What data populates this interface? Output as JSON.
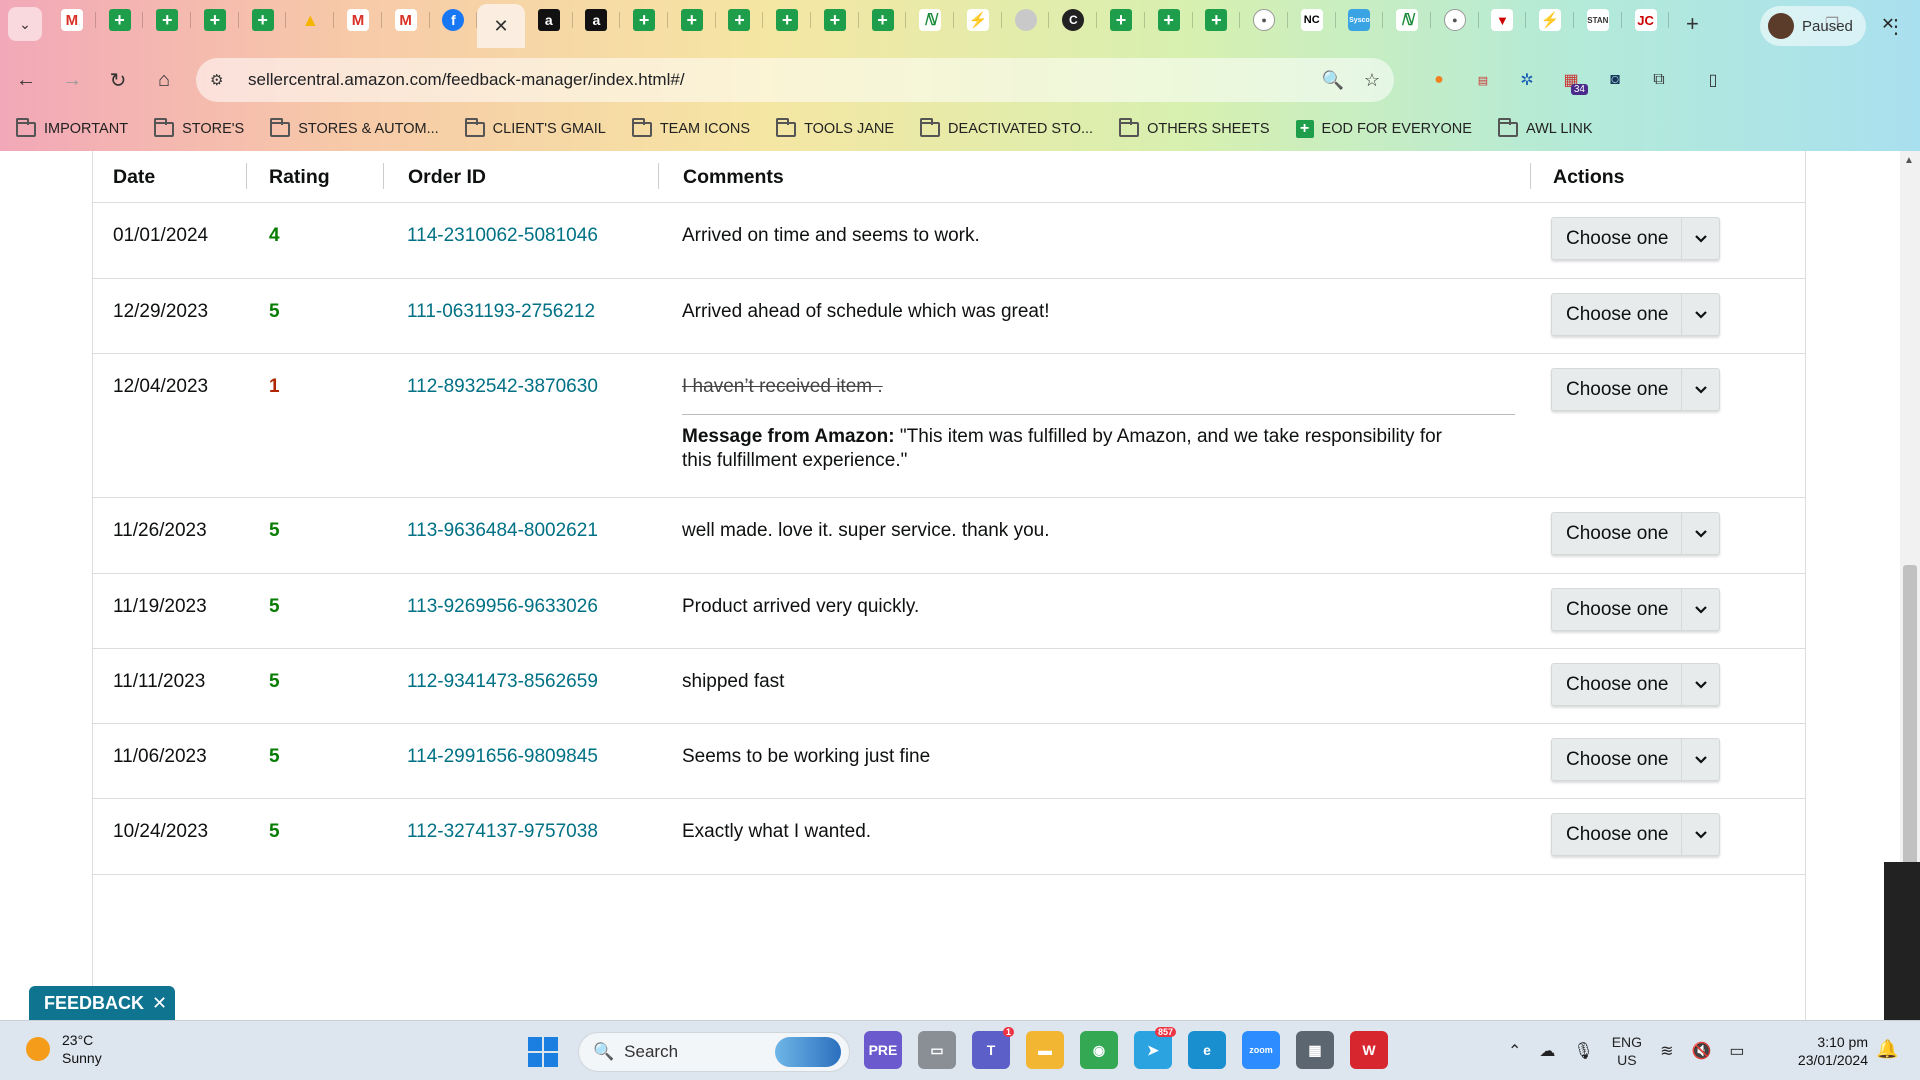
{
  "browser": {
    "tabs": [
      {
        "icon": "gmail-icon",
        "glyph": "M",
        "cls": "ic-gmail"
      },
      {
        "icon": "sheets-icon",
        "glyph": "+",
        "cls": "ic-sheet"
      },
      {
        "icon": "sheets-icon",
        "glyph": "+",
        "cls": "ic-sheet"
      },
      {
        "icon": "sheets-icon",
        "glyph": "+",
        "cls": "ic-sheet"
      },
      {
        "icon": "sheets-icon",
        "glyph": "+",
        "cls": "ic-sheet"
      },
      {
        "icon": "google-drive-icon",
        "glyph": "▲",
        "cls": "ic-drive"
      },
      {
        "icon": "gmail-icon",
        "glyph": "M",
        "cls": "ic-gmail"
      },
      {
        "icon": "gmail-icon",
        "glyph": "M",
        "cls": "ic-gmail"
      },
      {
        "icon": "facebook-icon",
        "glyph": "f",
        "cls": "ic-fb"
      },
      {
        "icon": "close-icon",
        "glyph": "✕",
        "cls": "ic-close",
        "active": true
      },
      {
        "icon": "amazon-icon",
        "glyph": "a",
        "cls": "ic-amazon"
      },
      {
        "icon": "amazon-icon",
        "glyph": "a",
        "cls": "ic-amazon"
      },
      {
        "icon": "sheets-icon",
        "glyph": "+",
        "cls": "ic-sheet"
      },
      {
        "icon": "sheets-icon",
        "glyph": "+",
        "cls": "ic-sheet"
      },
      {
        "icon": "sheets-icon",
        "glyph": "+",
        "cls": "ic-sheet"
      },
      {
        "icon": "sheets-icon",
        "glyph": "+",
        "cls": "ic-sheet"
      },
      {
        "icon": "sheets-icon",
        "glyph": "+",
        "cls": "ic-sheet"
      },
      {
        "icon": "sheets-icon",
        "glyph": "+",
        "cls": "ic-sheet"
      },
      {
        "icon": "n-logo-icon",
        "glyph": "ℕ",
        "cls": "ic-n"
      },
      {
        "icon": "zapier-icon",
        "glyph": "⚡",
        "cls": "ic-zap"
      },
      {
        "icon": "loading-icon",
        "glyph": "",
        "cls": "ic-grey"
      },
      {
        "icon": "c-logo-icon",
        "glyph": "C",
        "cls": "ic-c"
      },
      {
        "icon": "sheets-icon",
        "glyph": "+",
        "cls": "ic-sheet"
      },
      {
        "icon": "sheets-icon",
        "glyph": "+",
        "cls": "ic-sheet"
      },
      {
        "icon": "sheets-icon",
        "glyph": "+",
        "cls": "ic-sheet"
      },
      {
        "icon": "round-logo-icon",
        "glyph": "●",
        "cls": "ic-round"
      },
      {
        "icon": "nc-logo-icon",
        "glyph": "NC",
        "cls": "ic-nc"
      },
      {
        "icon": "sysco-logo-icon",
        "glyph": "Sysco",
        "cls": "ic-sysco"
      },
      {
        "icon": "n-logo-icon",
        "glyph": "ℕ",
        "cls": "ic-n"
      },
      {
        "icon": "round-logo-icon",
        "glyph": "●",
        "cls": "ic-round"
      },
      {
        "icon": "red-logo-icon",
        "glyph": "▼",
        "cls": "ic-red"
      },
      {
        "icon": "zapier-icon",
        "glyph": "⚡",
        "cls": "ic-zap"
      },
      {
        "icon": "stan-logo-icon",
        "glyph": "STAN",
        "cls": "ic-txt"
      },
      {
        "icon": "jc-logo-icon",
        "glyph": "JC",
        "cls": "ic-red"
      }
    ],
    "url": "sellercentral.amazon.com/feedback-manager/index.html#/",
    "profile_label": "Paused",
    "extension_badge": "34",
    "bookmarks": [
      {
        "label": "IMPORTANT",
        "type": "folder"
      },
      {
        "label": "STORE'S",
        "type": "folder"
      },
      {
        "label": "STORES & AUTOM...",
        "type": "folder"
      },
      {
        "label": "CLIENT'S GMAIL",
        "type": "folder"
      },
      {
        "label": "TEAM ICONS",
        "type": "folder"
      },
      {
        "label": "TOOLS JANE",
        "type": "folder"
      },
      {
        "label": "DEACTIVATED STO...",
        "type": "folder"
      },
      {
        "label": "OTHERS SHEETS",
        "type": "folder"
      },
      {
        "label": "EOD FOR EVERYONE",
        "type": "sheet"
      },
      {
        "label": "AWL LINK",
        "type": "folder"
      }
    ]
  },
  "table": {
    "headers": {
      "date": "Date",
      "rating": "Rating",
      "order_id": "Order ID",
      "comments": "Comments",
      "actions": "Actions"
    },
    "rows": [
      {
        "date": "01/01/2024",
        "rating": "4",
        "order_id": "114-2310062-5081046",
        "comment": "Arrived on time and seems to work.",
        "action": "Choose one"
      },
      {
        "date": "12/29/2023",
        "rating": "5",
        "order_id": "111-0631193-2756212",
        "comment": "Arrived ahead of schedule which was great!",
        "action": "Choose one"
      },
      {
        "date": "12/04/2023",
        "rating": "1",
        "order_id": "112-8932542-3870630",
        "comment": "I haven’t received item .",
        "struck": true,
        "amazon_label": "Message from Amazon:",
        "amazon_message": "\"This item was fulfilled by Amazon, and we take responsibility for this fulfillment experience.\"",
        "action": "Choose one"
      },
      {
        "date": "11/26/2023",
        "rating": "5",
        "order_id": "113-9636484-8002621",
        "comment": "well made. love it. super service. thank you.",
        "action": "Choose one"
      },
      {
        "date": "11/19/2023",
        "rating": "5",
        "order_id": "113-9269956-9633026",
        "comment": "Product arrived very quickly.",
        "action": "Choose one"
      },
      {
        "date": "11/11/2023",
        "rating": "5",
        "order_id": "112-9341473-8562659",
        "comment": "shipped fast",
        "action": "Choose one"
      },
      {
        "date": "11/06/2023",
        "rating": "5",
        "order_id": "114-2991656-9809845",
        "comment": "Seems to be working just fine",
        "action": "Choose one"
      },
      {
        "date": "10/24/2023",
        "rating": "5",
        "order_id": "112-3274137-9757038",
        "comment": "Exactly what I wanted.",
        "action": "Choose one"
      }
    ]
  },
  "feedback_tab": {
    "label": "FEEDBACK"
  },
  "taskbar": {
    "weather_temp": "23°C",
    "weather_desc": "Sunny",
    "search_label": "Search",
    "apps": [
      {
        "icon": "copilot-icon",
        "glyph": "PRE",
        "color": "#6a5acd"
      },
      {
        "icon": "file-manager-icon",
        "glyph": "▭",
        "color": "#8a8f96"
      },
      {
        "icon": "teams-icon",
        "glyph": "T",
        "color": "#5b5fc7",
        "count": "1"
      },
      {
        "icon": "folder-icon",
        "glyph": "▬",
        "color": "#f2b632"
      },
      {
        "icon": "chrome-icon",
        "glyph": "◉",
        "color": "#34a853"
      },
      {
        "icon": "telegram-icon",
        "glyph": "➤",
        "color": "#2aa3e0",
        "count": "857"
      },
      {
        "icon": "edge-icon",
        "glyph": "e",
        "color": "#1a8fd0"
      },
      {
        "icon": "zoom-icon",
        "glyph": "zoom",
        "color": "#2d8cff"
      },
      {
        "icon": "calculator-icon",
        "glyph": "▦",
        "color": "#5b6670"
      },
      {
        "icon": "wps-icon",
        "glyph": "W",
        "color": "#d8262f"
      }
    ],
    "lang_primary": "ENG",
    "lang_secondary": "US",
    "time": "3:10 pm",
    "date": "23/01/2024"
  }
}
